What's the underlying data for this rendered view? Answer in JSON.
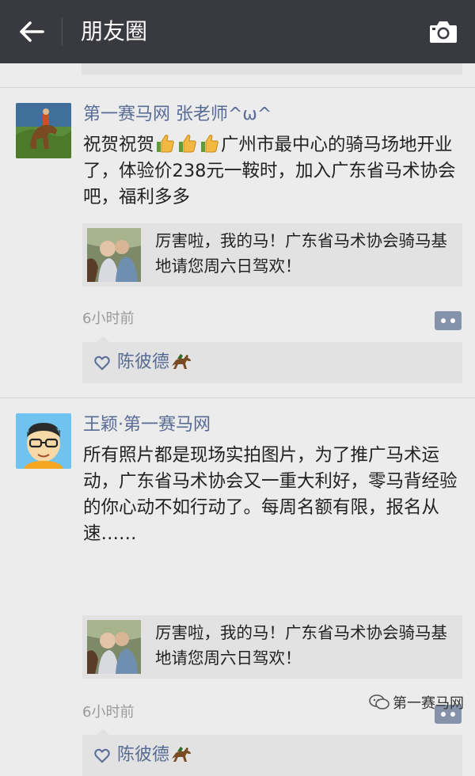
{
  "header": {
    "title": "朋友圈",
    "back_icon": "arrow-left-icon",
    "camera_icon": "camera-icon"
  },
  "colors": {
    "topbar": "#393a3f",
    "name_link": "#576b95",
    "background": "#ececec",
    "card": "#e2e2e2"
  },
  "posts": [
    {
      "author": "第一赛马网 张老师^ω^",
      "text_prefix": "祝贺祝贺",
      "text_suffix": "广州市最中心的骑马场地开业了，体验价238元一鞍时，加入广东省马术协会吧，福利多多",
      "emoji": "thumbs-up-icon",
      "share_text": "厉害啦，我的马！广东省马术协会骑马基地请您周六日驾欢！",
      "time": "6小时前",
      "like_name": "陈彼德",
      "like_emoji": "horse-icon"
    },
    {
      "author": "王颖·第一赛马网",
      "text": "所有照片都是现场实拍图片，为了推广马术运动，广东省马术协会又一重大利好，零马背经验的你心动不如行动了。每周名额有限，报名从速……",
      "share_text": "厉害啦，我的马！广东省马术协会骑马基地请您周六日驾欢！",
      "time": "6小时前",
      "like_name": "陈彼德",
      "like_emoji": "horse-icon"
    }
  ],
  "watermark": {
    "text": "第一赛马网",
    "icon": "wechat-icon"
  }
}
